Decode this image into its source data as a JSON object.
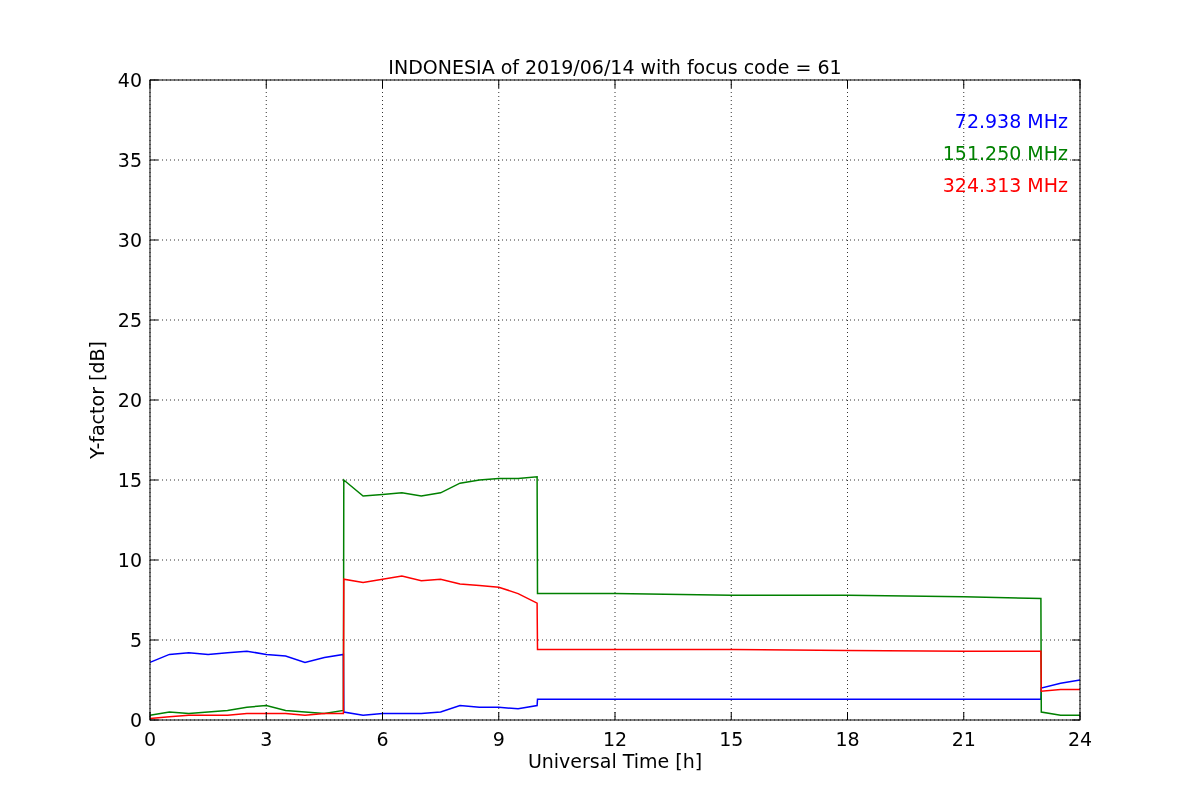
{
  "chart_data": {
    "type": "line",
    "title": "INDONESIA of 2019/06/14 with focus code = 61",
    "xlabel": "Universal Time [h]",
    "ylabel": "Y-factor [dB]",
    "x": [
      0,
      0.5,
      1,
      1.5,
      2,
      2.5,
      3,
      3.5,
      4,
      4.5,
      4.99,
      5,
      5.5,
      6,
      6.5,
      7,
      7.5,
      8,
      8.5,
      9,
      9.5,
      9.99,
      10,
      12,
      15,
      18,
      21,
      22.99,
      23,
      23.5,
      24
    ],
    "series": [
      {
        "name": "72.938 MHz",
        "color": "#0000ff",
        "values": [
          3.6,
          4.1,
          4.2,
          4.1,
          4.2,
          4.3,
          4.1,
          4.0,
          3.6,
          3.9,
          4.1,
          0.5,
          0.3,
          0.4,
          0.4,
          0.4,
          0.5,
          0.9,
          0.8,
          0.8,
          0.7,
          0.9,
          1.3,
          1.3,
          1.3,
          1.3,
          1.3,
          1.3,
          2.0,
          2.3,
          2.5
        ]
      },
      {
        "name": "151.250 MHz",
        "color": "#008000",
        "values": [
          0.3,
          0.5,
          0.4,
          0.5,
          0.6,
          0.8,
          0.9,
          0.6,
          0.5,
          0.4,
          0.6,
          15.0,
          14.0,
          14.1,
          14.2,
          14.0,
          14.2,
          14.8,
          15.0,
          15.1,
          15.1,
          15.2,
          7.9,
          7.9,
          7.8,
          7.8,
          7.7,
          7.6,
          0.5,
          0.3,
          0.3
        ]
      },
      {
        "name": "324.313 MHz",
        "color": "#ff0000",
        "values": [
          0.1,
          0.2,
          0.3,
          0.3,
          0.3,
          0.4,
          0.4,
          0.4,
          0.3,
          0.4,
          0.4,
          8.8,
          8.6,
          8.8,
          9.0,
          8.7,
          8.8,
          8.5,
          8.4,
          8.3,
          7.9,
          7.3,
          4.4,
          4.4,
          4.4,
          4.35,
          4.3,
          4.3,
          1.8,
          1.9,
          1.9
        ]
      }
    ],
    "grid": true,
    "xlim": [
      0,
      24
    ],
    "ylim": [
      0,
      40
    ],
    "xticks": [
      0,
      3,
      6,
      9,
      12,
      15,
      18,
      21,
      24
    ],
    "yticks": [
      0,
      5,
      10,
      15,
      20,
      25,
      30,
      35,
      40
    ]
  }
}
